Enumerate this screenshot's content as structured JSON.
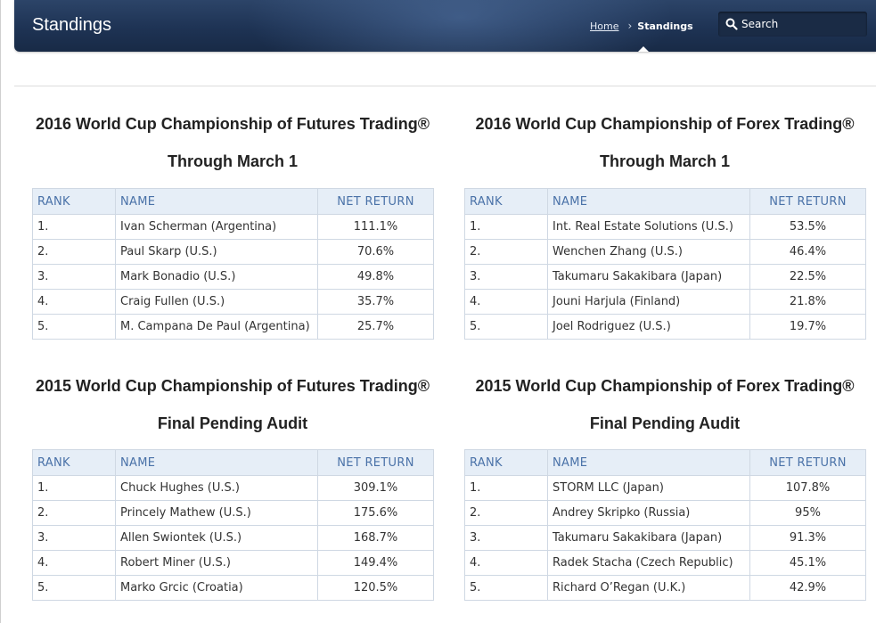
{
  "header": {
    "title": "Standings",
    "breadcrumb": {
      "home": "Home",
      "current": "Standings"
    },
    "search": {
      "placeholder": "Search"
    }
  },
  "columns": {
    "rank": "RANK",
    "name": "NAME",
    "net_return": "NET RETURN"
  },
  "panels": [
    {
      "title": "2016 World Cup Championship of Futures Trading®",
      "subtitle": "Through March 1",
      "rows": [
        {
          "rank": "1.",
          "name": "Ivan Scherman (Argentina)",
          "ret": "111.1%"
        },
        {
          "rank": "2.",
          "name": "Paul Skarp (U.S.)",
          "ret": "70.6%"
        },
        {
          "rank": "3.",
          "name": "Mark Bonadio (U.S.)",
          "ret": "49.8%"
        },
        {
          "rank": "4.",
          "name": "Craig Fullen (U.S.)",
          "ret": "35.7%"
        },
        {
          "rank": "5.",
          "name": "M. Campana De Paul (Argentina)",
          "ret": "25.7%"
        }
      ]
    },
    {
      "title": "2016 World Cup Championship of Forex Trading®",
      "subtitle": "Through March 1",
      "rows": [
        {
          "rank": "1.",
          "name": "Int. Real Estate Solutions (U.S.)",
          "ret": "53.5%"
        },
        {
          "rank": "2.",
          "name": "Wenchen Zhang (U.S.)",
          "ret": "46.4%"
        },
        {
          "rank": "3.",
          "name": "Takumaru Sakakibara (Japan)",
          "ret": "22.5%"
        },
        {
          "rank": "4.",
          "name": "Jouni Harjula (Finland)",
          "ret": "21.8%"
        },
        {
          "rank": "5.",
          "name": "Joel Rodriguez (U.S.)",
          "ret": "19.7%"
        }
      ]
    },
    {
      "title": "2015 World Cup Championship of Futures Trading®",
      "subtitle": "Final Pending Audit",
      "rows": [
        {
          "rank": "1.",
          "name": "Chuck Hughes (U.S.)",
          "ret": "309.1%"
        },
        {
          "rank": "2.",
          "name": "Princely Mathew (U.S.)",
          "ret": "175.6%"
        },
        {
          "rank": "3.",
          "name": "Allen Swiontek (U.S.)",
          "ret": "168.7%"
        },
        {
          "rank": "4.",
          "name": "Robert Miner (U.S.)",
          "ret": "149.4%"
        },
        {
          "rank": "5.",
          "name": "Marko Grcic (Croatia)",
          "ret": "120.5%"
        }
      ]
    },
    {
      "title": "2015 World Cup Championship of Forex Trading®",
      "subtitle": "Final Pending Audit",
      "rows": [
        {
          "rank": "1.",
          "name": "STORM LLC (Japan)",
          "ret": "107.8%"
        },
        {
          "rank": "2.",
          "name": "Andrey Skripko (Russia)",
          "ret": "95%"
        },
        {
          "rank": "3.",
          "name": "Takumaru Sakakibara (Japan)",
          "ret": "91.3%"
        },
        {
          "rank": "4.",
          "name": "Radek Stacha (Czech Republic)",
          "ret": "45.1%"
        },
        {
          "rank": "5.",
          "name": "Richard O’Regan (U.K.)",
          "ret": "42.9%"
        }
      ]
    }
  ]
}
